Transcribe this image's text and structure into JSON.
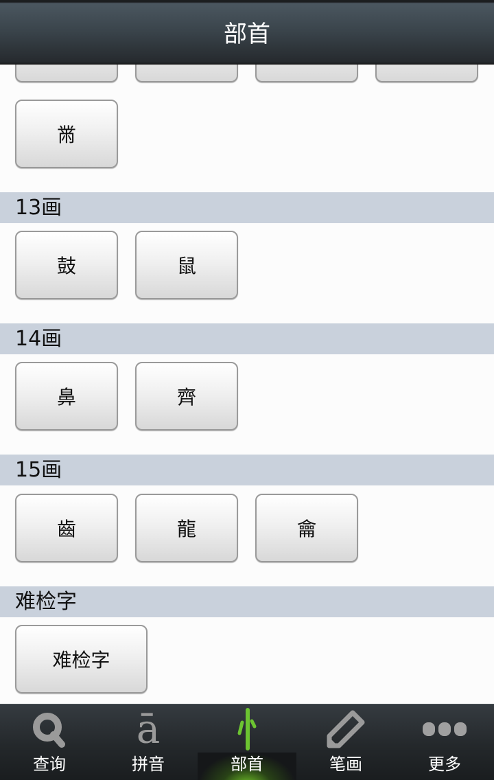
{
  "header": {
    "title": "部首"
  },
  "sections": [
    {
      "id": "12",
      "label": "",
      "items": [
        "",
        "",
        "",
        "",
        "黹"
      ]
    },
    {
      "id": "13",
      "label": "13画",
      "items": [
        "鼓",
        "鼠"
      ]
    },
    {
      "id": "14",
      "label": "14画",
      "items": [
        "鼻",
        "齊"
      ]
    },
    {
      "id": "15",
      "label": "15画",
      "items": [
        "齒",
        "龍",
        "龠"
      ]
    },
    {
      "id": "hard",
      "label": "难检字",
      "items": [
        "难检字"
      ]
    }
  ],
  "tabbar": {
    "active": "部首",
    "tabs": [
      {
        "label": "查询",
        "icon": "search-icon"
      },
      {
        "label": "拼音",
        "icon": "pinyin-a-macron-icon",
        "glyph": "ā"
      },
      {
        "label": "部首",
        "icon": "radical-icon",
        "glyph": "忄"
      },
      {
        "label": "笔画",
        "icon": "pencil-icon"
      },
      {
        "label": "更多",
        "icon": "more-dots-icon"
      }
    ]
  },
  "colors": {
    "accent": "#6cc431",
    "section_header_bg": "#c9d1dc",
    "titlebar_bg": "#3a444b"
  }
}
